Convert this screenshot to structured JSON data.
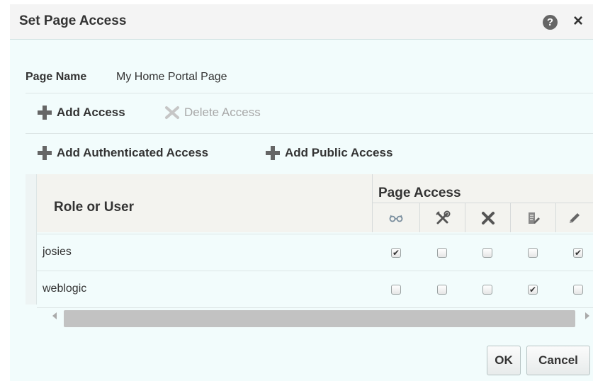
{
  "dialog": {
    "title": "Set Page Access",
    "help_icon": "question-circle-icon",
    "close_icon": "close-icon"
  },
  "page_name": {
    "label": "Page Name",
    "value": "My Home Portal Page"
  },
  "toolbar": {
    "add_access": "Add Access",
    "delete_access": "Delete Access",
    "add_authenticated": "Add Authenticated Access",
    "add_public": "Add Public Access"
  },
  "table": {
    "col_role": "Role or User",
    "col_group": "Page Access",
    "permission_icons": [
      "view-glasses-icon",
      "customize-tools-icon",
      "delete-x-icon",
      "edit-page-icon",
      "pencil-icon"
    ],
    "rows": [
      {
        "name": "josies",
        "perms": [
          true,
          false,
          false,
          false,
          true
        ]
      },
      {
        "name": "weblogic",
        "perms": [
          false,
          false,
          false,
          true,
          false
        ]
      }
    ]
  },
  "footer": {
    "ok": "OK",
    "cancel": "Cancel"
  }
}
